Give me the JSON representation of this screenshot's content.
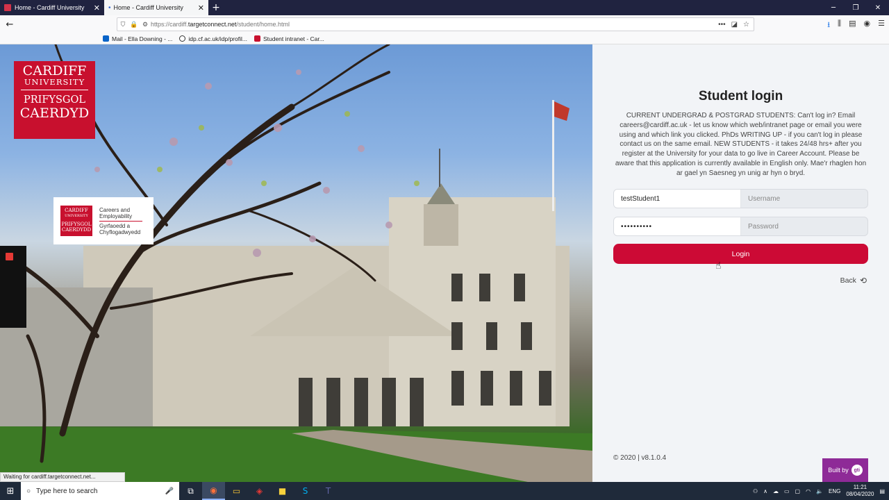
{
  "browser": {
    "tabs": [
      {
        "title": "Home - Cardiff University",
        "active": false
      },
      {
        "title": "Home - Cardiff University",
        "active": true
      }
    ],
    "url_prefix": "https://cardiff.",
    "url_host": "targetconnect.net",
    "url_path": "/student/home.html",
    "bookmarks": [
      "Mail - Ella Downing - ...",
      "idp.cf.ac.uk/idp/profil...",
      "Student intranet - Car..."
    ],
    "status_text": "Waiting for cardiff.targetconnect.net..."
  },
  "branding": {
    "logo_line1": "CARDIFF",
    "logo_line2": "UNIVERSITY",
    "logo_line3": "PRIFYSGOL",
    "logo_line4": "CAERDYD",
    "careers_mini_1": "CARDIFF",
    "careers_mini_2": "UNIVERSITY",
    "careers_mini_3": "PRIFYSGOL",
    "careers_mini_4": "CAERDYDD",
    "careers_en": "Careers and Employability",
    "careers_cy": "Gyrfaoedd a Chyflogadwyedd"
  },
  "login": {
    "title": "Student login",
    "description": "CURRENT UNDERGRAD & POSTGRAD STUDENTS: Can't log in? Email careers@cardiff.ac.uk - let us know which web/intranet page or email you were using and which link you clicked. PhDs WRITING UP - if you can't log in please contact us on the same email. NEW STUDENTS - it takes 24/48 hrs+ after you register at the University for your data to go live in Career Account. Please be aware that this application is currently available in English only. Mae'r rhaglen hon ar gael yn Saesneg yn unig ar hyn o bryd.",
    "username_value": "testStudent1",
    "username_label": "Username",
    "password_value": "••••••••••",
    "password_label": "Password",
    "login_button": "Login",
    "back_link": "Back",
    "version": "© 2020 | v8.1.0.4",
    "built_by": "Built by"
  },
  "taskbar": {
    "search_placeholder": "Type here to search",
    "language": "ENG",
    "time": "11:21",
    "date": "08/04/2020"
  },
  "colors": {
    "accent": "#cc0a35",
    "brand_red": "#c8102e",
    "built_by_bg": "#8e2a97"
  }
}
